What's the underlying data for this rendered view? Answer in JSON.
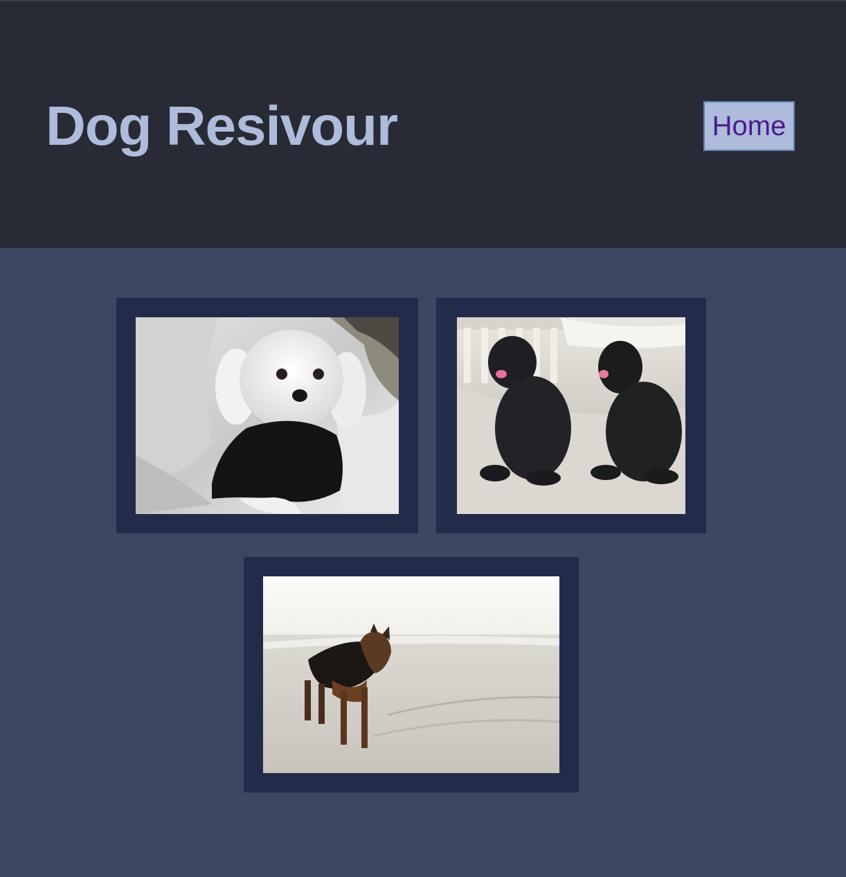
{
  "header": {
    "title": "Dog Resivour",
    "nav": {
      "home_label": "Home"
    }
  },
  "gallery": {
    "photos": [
      {
        "subject": "white-dog-in-black-sweater-photo"
      },
      {
        "subject": "two-black-shaggy-dogs-photo"
      },
      {
        "subject": "dog-on-beach-photo"
      }
    ]
  },
  "colors": {
    "header_bg": "#282b35",
    "page_bg": "#3d4761",
    "card_bg": "#222b49",
    "title_text": "#aebbdb",
    "home_button_bg": "#aebbdb",
    "home_button_border": "#5e83b4",
    "home_button_text": "#4b1b8f"
  }
}
